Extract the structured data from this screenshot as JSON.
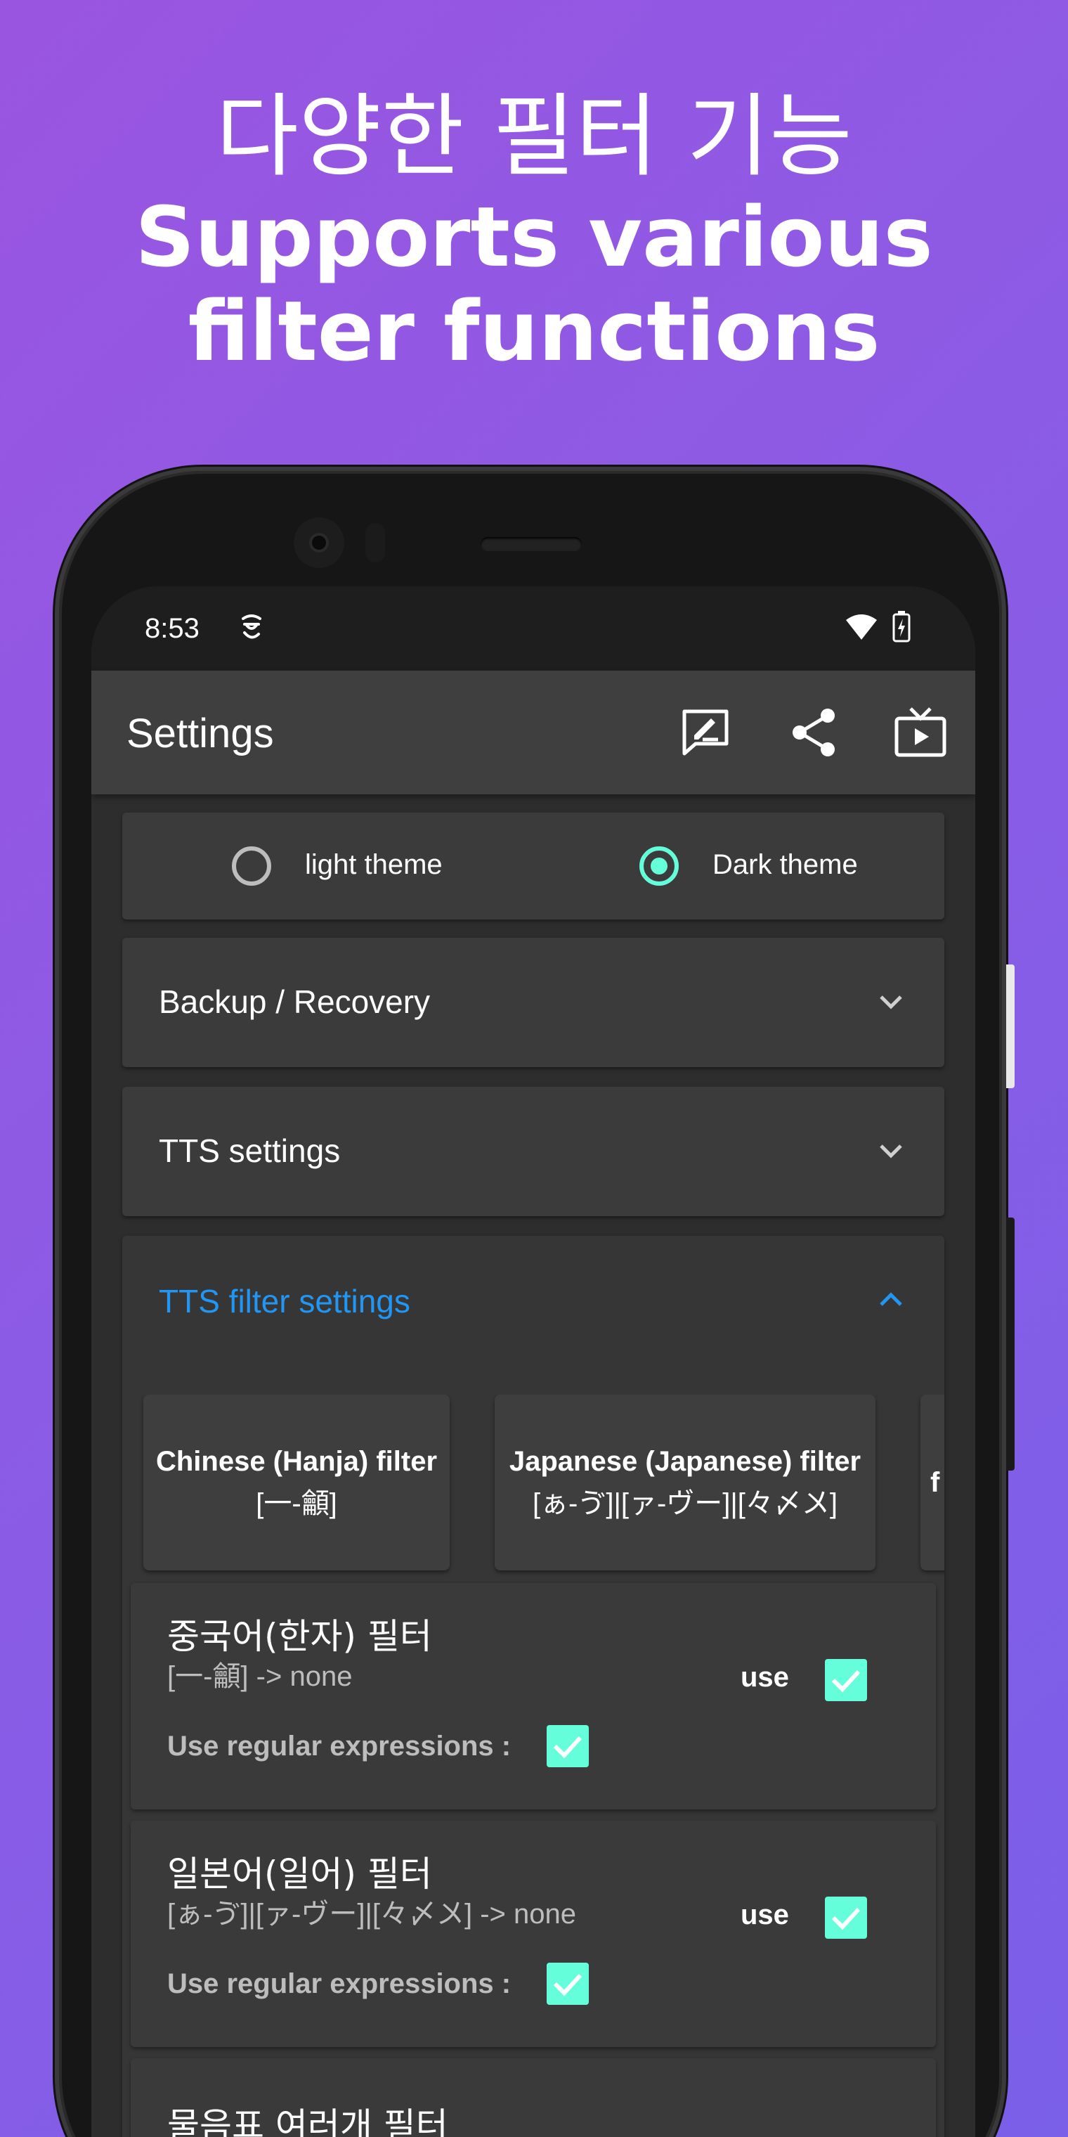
{
  "headline": {
    "korean": "다양한 필터 기능",
    "english_line1": "Supports various",
    "english_line2": "filter functions"
  },
  "status_bar": {
    "time": "8:53"
  },
  "app_bar": {
    "title": "Settings",
    "icons": [
      "feedback-icon",
      "share-icon",
      "tv-play-icon"
    ]
  },
  "theme": {
    "light_label": "light theme",
    "dark_label": "Dark theme",
    "selected": "dark"
  },
  "sections": {
    "backup": "Backup / Recovery",
    "tts": "TTS settings",
    "tts_filter": "TTS filter settings"
  },
  "filter_chips": [
    {
      "line1": "Chinese (Hanja) filter",
      "line2": "[一-龥]"
    },
    {
      "line1": "Japanese (Japanese) filter",
      "line2": "[ぁ-ゔ]|[ァ-ヴー]|[々〆〤]"
    },
    {
      "line1": "f",
      "line2": ""
    }
  ],
  "filters": [
    {
      "name": "중국어(한자) 필터",
      "pattern": "[一-龥]   ->   none",
      "use_label": "use",
      "use_checked": true,
      "regex_label": "Use regular expressions :",
      "regex_checked": true
    },
    {
      "name": "일본어(일어) 필터",
      "pattern": "[ぁ-ゔ]|[ァ-ヴー]|[々〆〤]   ->   none",
      "use_label": "use",
      "use_checked": true,
      "regex_label": "Use regular expressions :",
      "regex_checked": true
    },
    {
      "name": "물음표 여러개 필터"
    }
  ],
  "colors": {
    "accent": "#64ffda",
    "section_active": "#2196f3",
    "card_bg": "#3b3b3b",
    "screen_bg": "#2d2d2d"
  }
}
